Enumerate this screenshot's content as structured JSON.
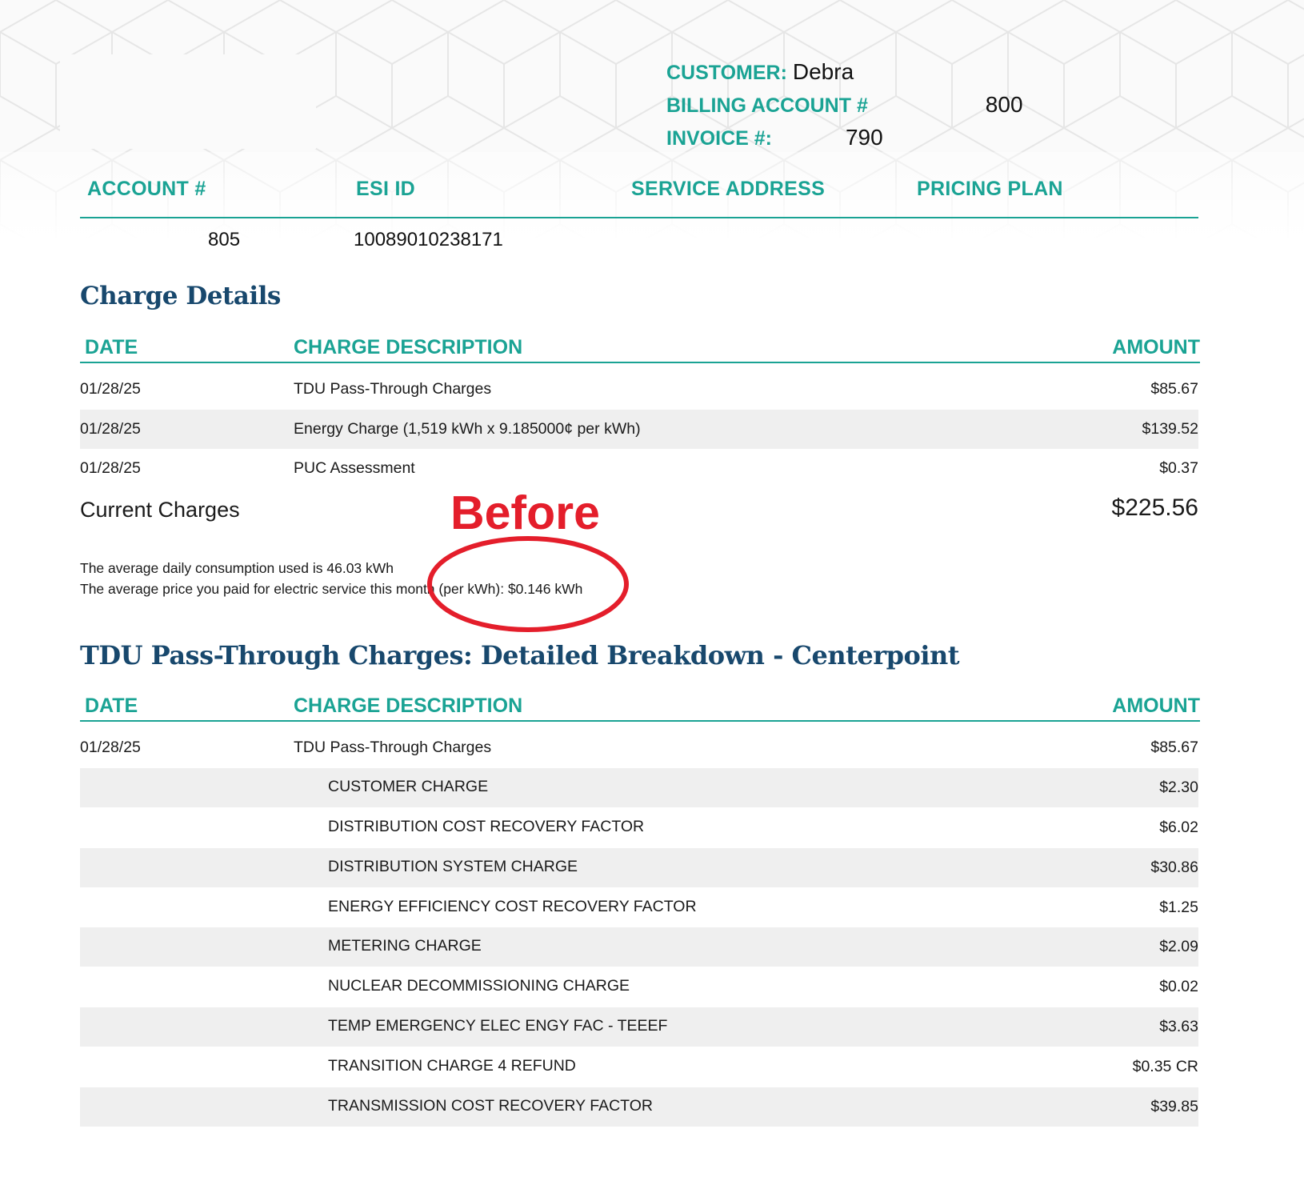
{
  "header": {
    "customer_label": "CUSTOMER:",
    "customer_value": "Debra",
    "billing_account_label": "BILLING ACCOUNT #",
    "billing_account_value": "800",
    "invoice_label": "INVOICE #:",
    "invoice_value": "790"
  },
  "account_table": {
    "headers": [
      "ACCOUNT #",
      "ESI ID",
      "SERVICE ADDRESS",
      "PRICING PLAN"
    ],
    "account_number": "805",
    "esi_id": "10089010238171"
  },
  "charge_details": {
    "title": "Charge Details",
    "headers": {
      "date": "DATE",
      "description": "CHARGE DESCRIPTION",
      "amount": "AMOUNT"
    },
    "rows": [
      {
        "date": "01/28/25",
        "description": "TDU Pass-Through Charges",
        "amount": "$85.67"
      },
      {
        "date": "01/28/25",
        "description": "Energy Charge (1,519 kWh x 9.185000¢ per kWh)",
        "amount": "$139.52"
      },
      {
        "date": "01/28/25",
        "description": "PUC Assessment",
        "amount": "$0.37"
      }
    ],
    "current_charges_label": "Current Charges",
    "current_charges_amount": "$225.56",
    "note_daily": "The average daily consumption used is  46.03 kWh",
    "note_price": "The average price you paid for electric service this month (per kWh): $0.146 kWh"
  },
  "annotation": {
    "text": "Before",
    "color": "#e41e2b"
  },
  "tdu_breakdown": {
    "title": "TDU Pass-Through Charges: Detailed Breakdown - Centerpoint",
    "headers": {
      "date": "DATE",
      "description": "CHARGE DESCRIPTION",
      "amount": "AMOUNT"
    },
    "main_row": {
      "date": "01/28/25",
      "description": "TDU Pass-Through Charges",
      "amount": "$85.67"
    },
    "items": [
      {
        "description": "CUSTOMER CHARGE",
        "amount": "$2.30"
      },
      {
        "description": "DISTRIBUTION COST RECOVERY FACTOR",
        "amount": "$6.02"
      },
      {
        "description": "DISTRIBUTION SYSTEM CHARGE",
        "amount": "$30.86"
      },
      {
        "description": "ENERGY EFFICIENCY COST RECOVERY FACTOR",
        "amount": "$1.25"
      },
      {
        "description": "METERING CHARGE",
        "amount": "$2.09"
      },
      {
        "description": "NUCLEAR DECOMMISSIONING CHARGE",
        "amount": "$0.02"
      },
      {
        "description": "TEMP EMERGENCY ELEC ENGY FAC - TEEEF",
        "amount": "$3.63"
      },
      {
        "description": "TRANSITION CHARGE 4 REFUND",
        "amount": "$0.35 CR"
      },
      {
        "description": "TRANSMISSION COST RECOVERY FACTOR",
        "amount": "$39.85"
      }
    ]
  },
  "colors": {
    "teal": "#1aa394",
    "navy": "#18486d",
    "row_shade": "#efefef"
  }
}
